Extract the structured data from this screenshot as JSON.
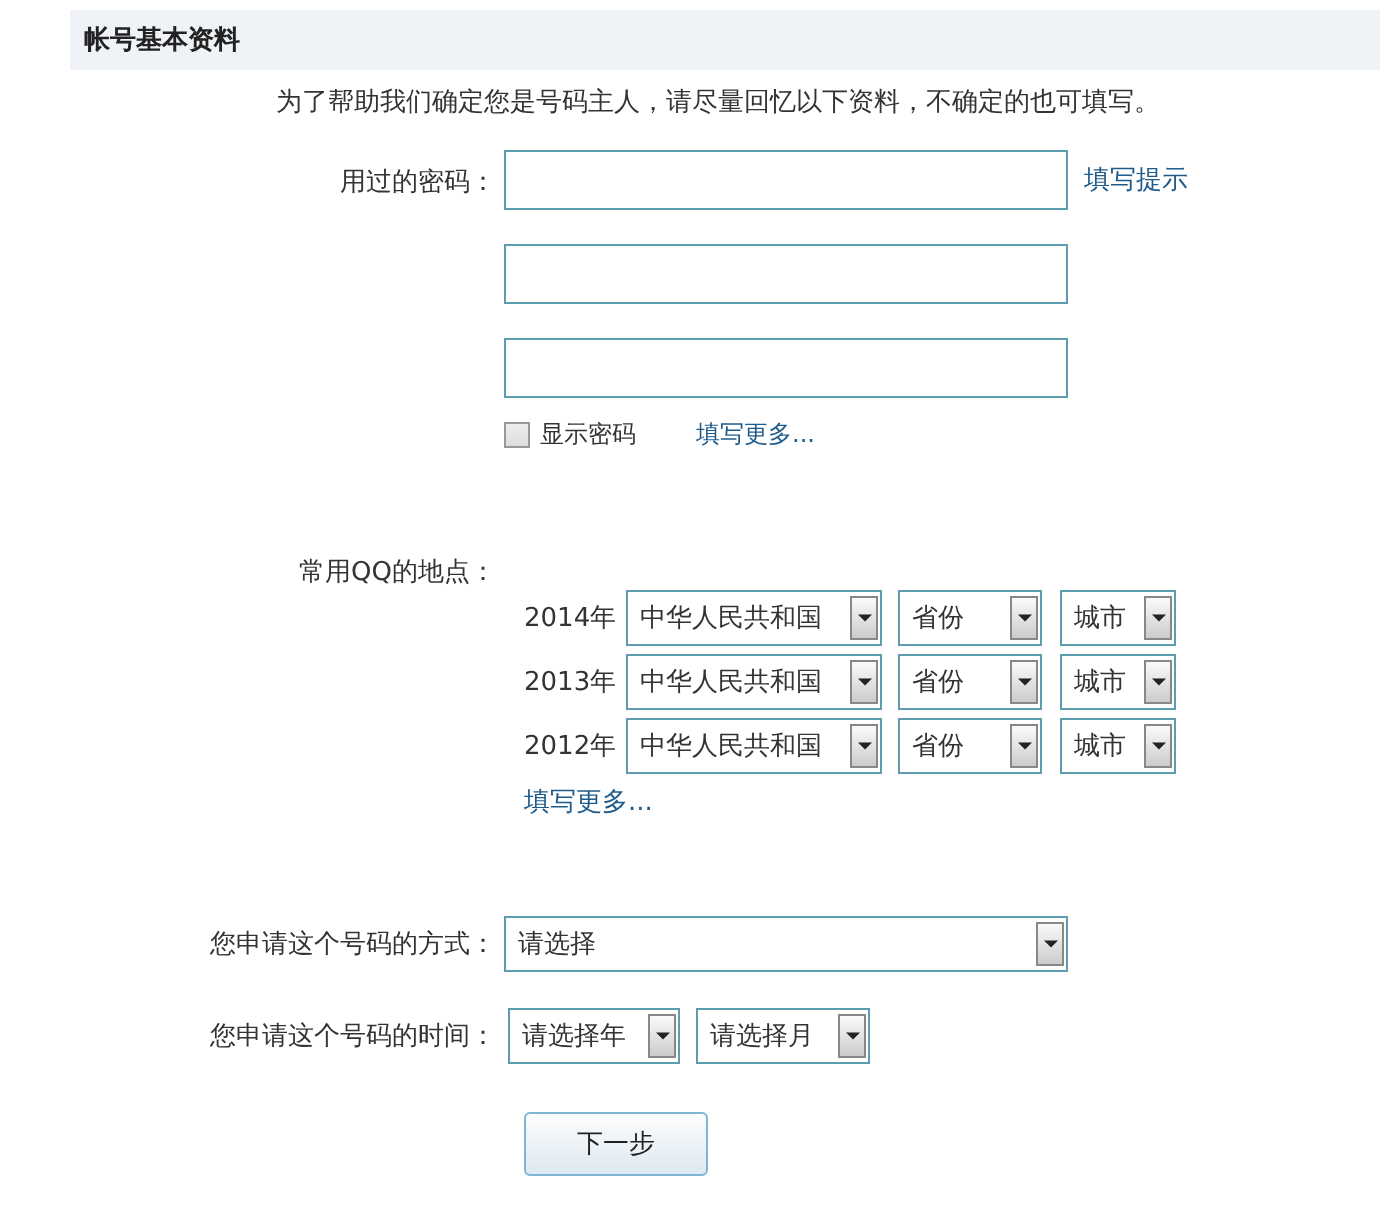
{
  "section_title": "帐号基本资料",
  "intro": "为了帮助我们确定您是号码主人，请尽量回忆以下资料，不确定的也可填写。",
  "password": {
    "label": "用过的密码：",
    "hint_link": "填写提示",
    "fields": [
      {
        "kind": "password"
      },
      {
        "kind": "password"
      },
      {
        "kind": "password"
      }
    ],
    "show_password": {
      "label": "显示密码",
      "checked": false
    },
    "more_link": "填写更多..."
  },
  "locations": {
    "label": "常用QQ的地点：",
    "rows": [
      {
        "year": "2014年",
        "country": "中华人民共和国",
        "province": "省份",
        "city": "城市"
      },
      {
        "year": "2013年",
        "country": "中华人民共和国",
        "province": "省份",
        "city": "城市"
      },
      {
        "year": "2012年",
        "country": "中华人民共和国",
        "province": "省份",
        "city": "城市"
      }
    ],
    "more_link": "填写更多..."
  },
  "method": {
    "label": "您申请这个号码的方式：",
    "value": "请选择"
  },
  "time": {
    "label": "您申请这个号码的时间：",
    "year": "请选择年",
    "month": "请选择月"
  },
  "next_button": "下一步"
}
